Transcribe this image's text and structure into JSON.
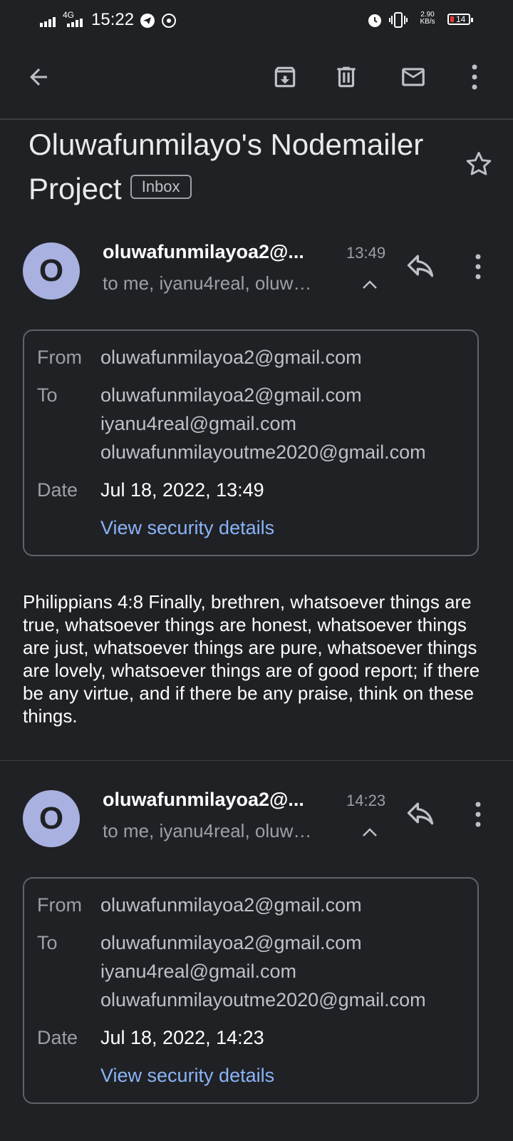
{
  "status_bar": {
    "network": "4G",
    "time": "15:22",
    "speed": "2.90",
    "speed_unit": "KB/s",
    "battery": "14"
  },
  "toolbar": {
    "back_icon": "arrow-back-icon",
    "archive_icon": "archive-icon",
    "delete_icon": "delete-icon",
    "mark_unread_icon": "mail-icon",
    "more_icon": "more-vert-icon"
  },
  "subject": {
    "title": "Oluwafunmilayo's Nodemailer Project",
    "label": "Inbox"
  },
  "messages": [
    {
      "avatar_letter": "O",
      "sender": "oluwafunmilayoa2@...",
      "time": "13:49",
      "recipients_summary": "to me, iyanu4real, oluw…",
      "details": {
        "from_label": "From",
        "from": "oluwafunmilayoa2@gmail.com",
        "to_label": "To",
        "to": [
          "oluwafunmilayoa2@gmail.com",
          "iyanu4real@gmail.com",
          "oluwafunmilayoutme2020@gmail.com"
        ],
        "date_label": "Date",
        "date": "Jul 18, 2022, 13:49",
        "security_link": "View security details"
      },
      "body": "Philippians 4:8  Finally, brethren, whatsoever things are true, whatsoever things are honest, whatsoever things are just, whatsoever things are pure, whatsoever things are lovely, whatsoever things are of good report; if there be any virtue, and if there be any praise, think on these things."
    },
    {
      "avatar_letter": "O",
      "sender": "oluwafunmilayoa2@...",
      "time": "14:23",
      "recipients_summary": "to me, iyanu4real, oluw…",
      "details": {
        "from_label": "From",
        "from": "oluwafunmilayoa2@gmail.com",
        "to_label": "To",
        "to": [
          "oluwafunmilayoa2@gmail.com",
          "iyanu4real@gmail.com",
          "oluwafunmilayoutme2020@gmail.com"
        ],
        "date_label": "Date",
        "date": "Jul 18, 2022, 14:23",
        "security_link": "View security details"
      }
    }
  ],
  "colors": {
    "background": "#202124",
    "avatar": "#a8b1e0",
    "link": "#8ab4f8"
  }
}
